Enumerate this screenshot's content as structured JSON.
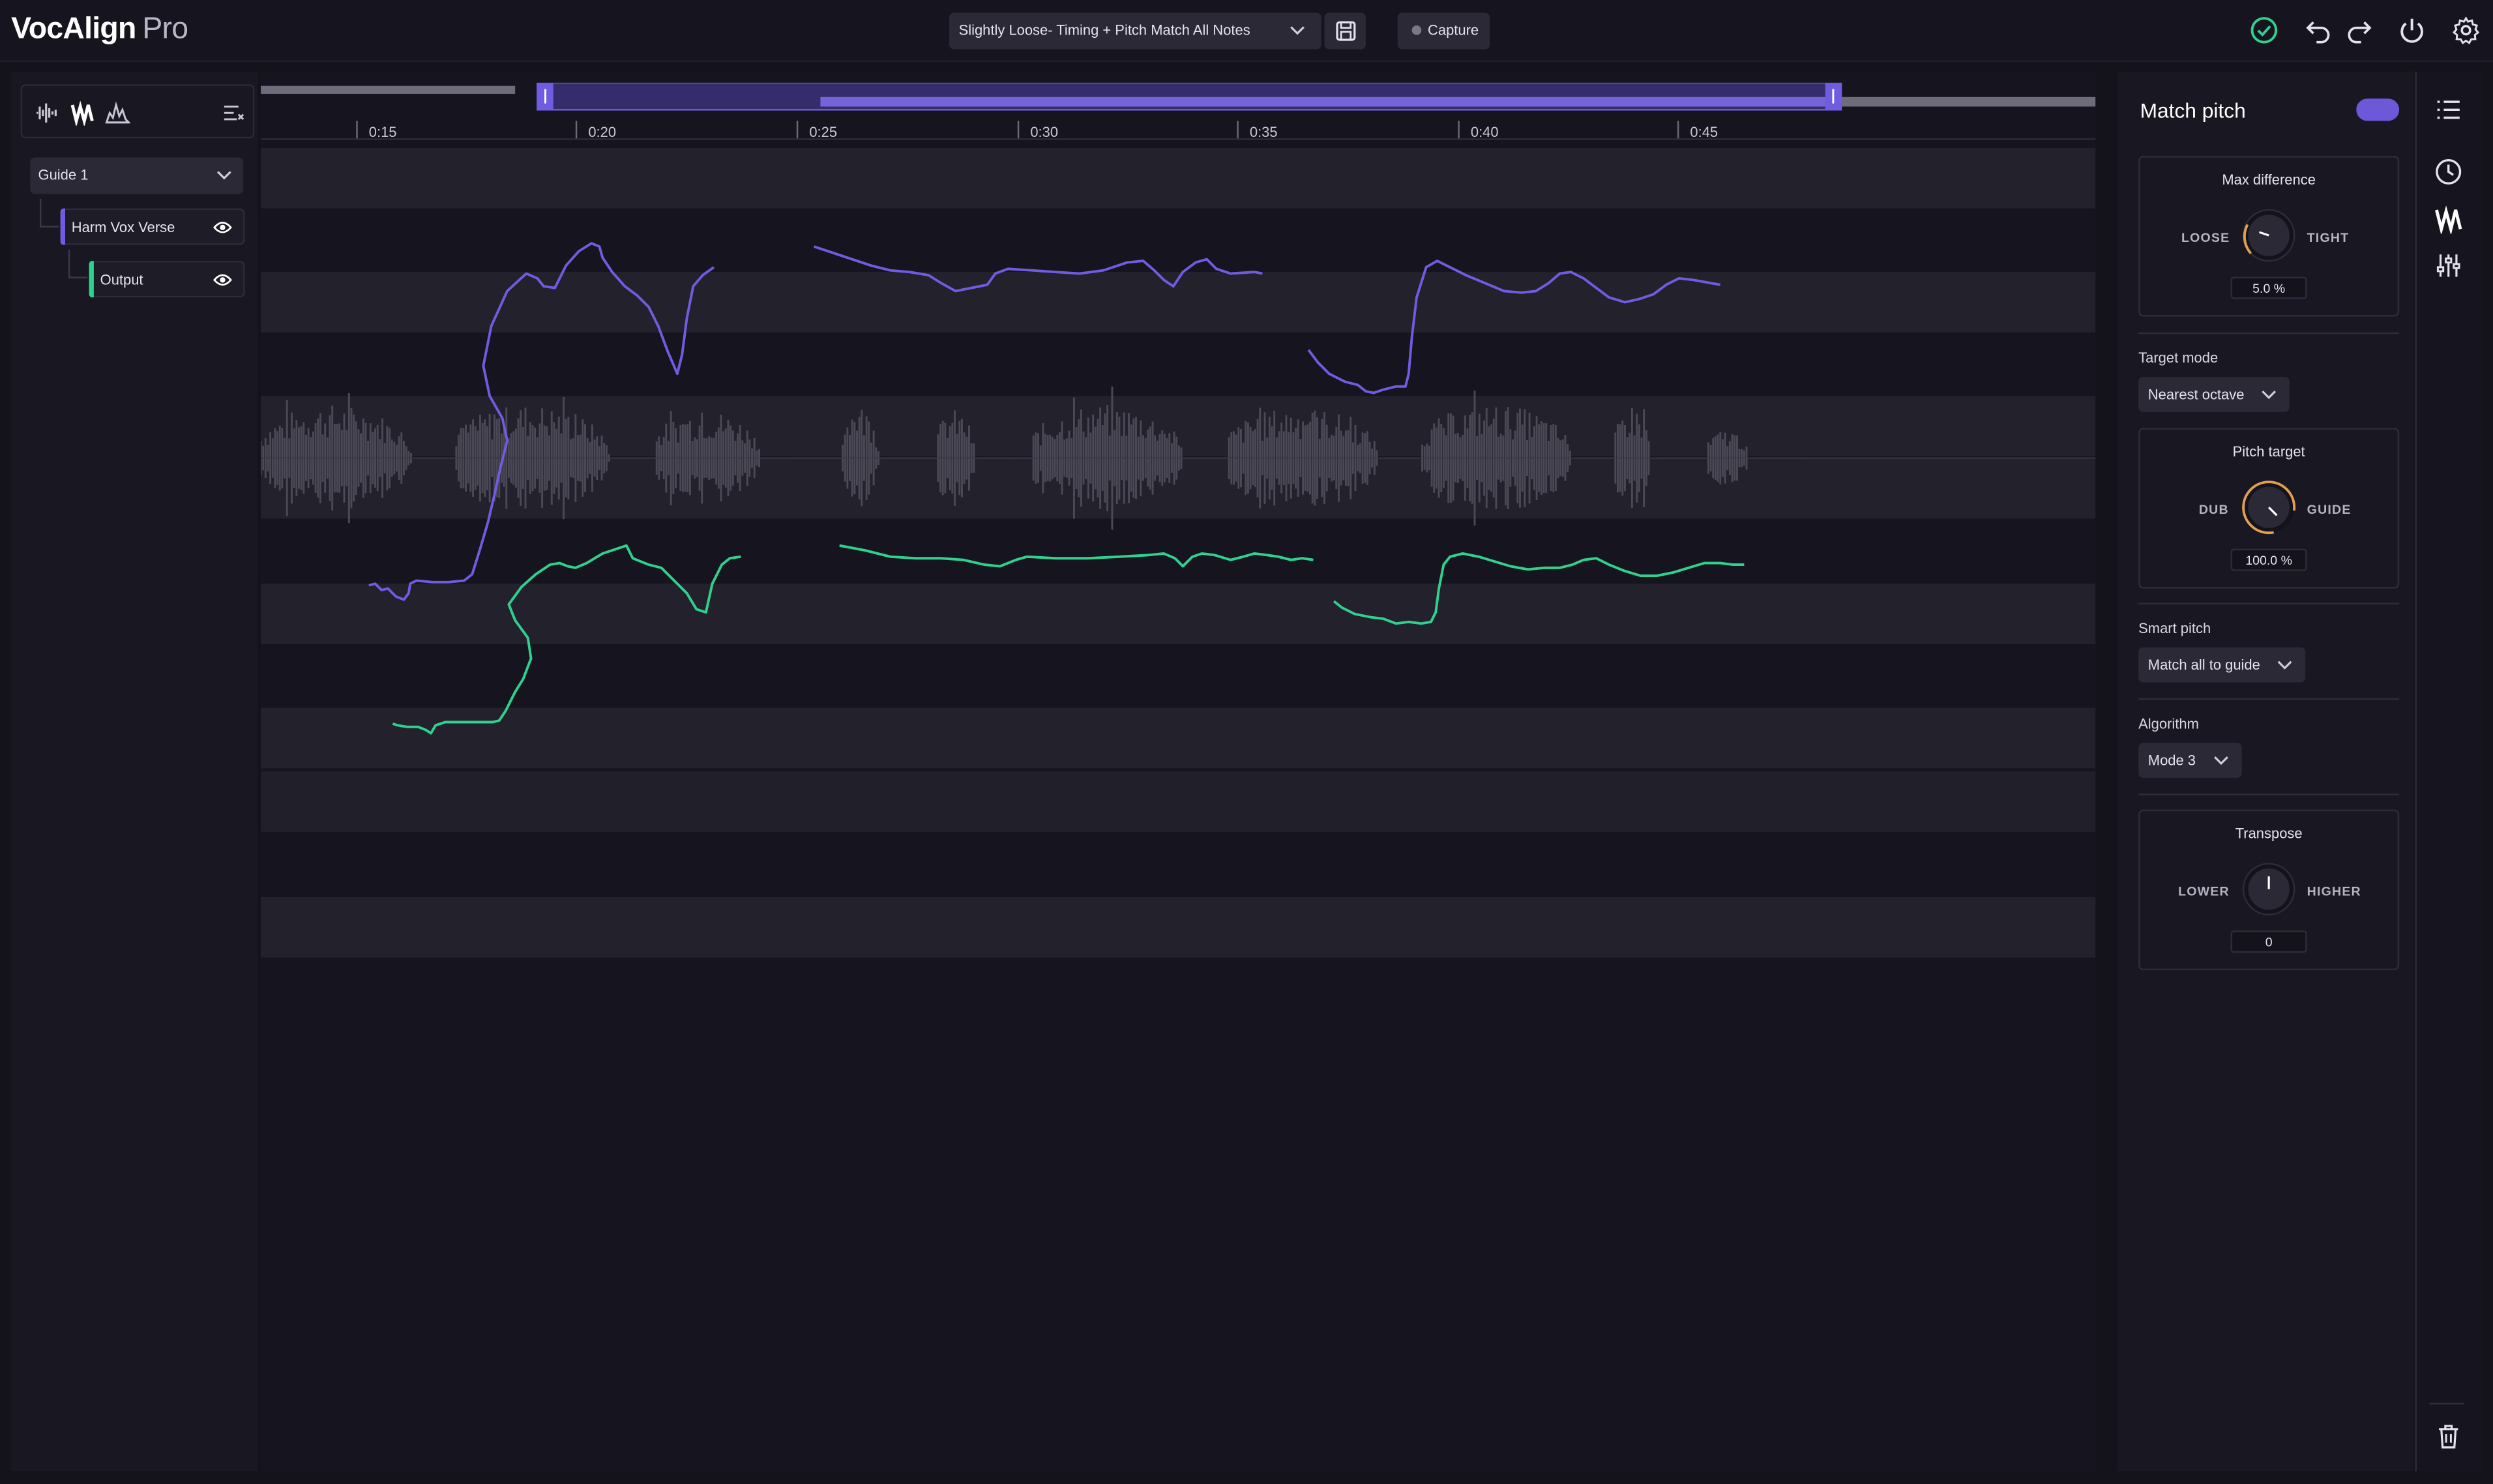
{
  "app": {
    "brand_bold": "VocAlign",
    "brand_light": "Pro"
  },
  "toolbar": {
    "preset_label": "Slightly Loose- Timing + Pitch Match All Notes",
    "capture_label": "Capture"
  },
  "left_panel": {
    "guide_select": "Guide 1",
    "tracks": [
      {
        "label": "Harm Vox Verse",
        "color": "#6f5ce0"
      },
      {
        "label": "Output",
        "color": "#2fd18e"
      }
    ]
  },
  "timeline": {
    "ticks": [
      "0:15",
      "0:20",
      "0:25",
      "0:30",
      "0:35",
      "0:40",
      "0:45"
    ]
  },
  "right_panel": {
    "title": "Match pitch",
    "match_pitch_enabled": true,
    "max_difference": {
      "title": "Max difference",
      "left": "LOOSE",
      "right": "TIGHT",
      "value": "5.0 %"
    },
    "target_mode": {
      "label": "Target mode",
      "value": "Nearest octave"
    },
    "pitch_target": {
      "title": "Pitch target",
      "left": "DUB",
      "right": "GUIDE",
      "value": "100.0 %"
    },
    "smart_pitch": {
      "label": "Smart pitch",
      "value": "Match all to guide"
    },
    "algorithm": {
      "label": "Algorithm",
      "value": "Mode 3"
    },
    "transpose": {
      "title": "Transpose",
      "left": "LOWER",
      "right": "HIGHER",
      "value": "0"
    }
  },
  "colors": {
    "accent": "#6f5ce0",
    "guide_pitch": "#6f5ce0",
    "output_pitch": "#2fd18e",
    "success": "#2fd18e",
    "knob_ring": "#e0a050"
  }
}
